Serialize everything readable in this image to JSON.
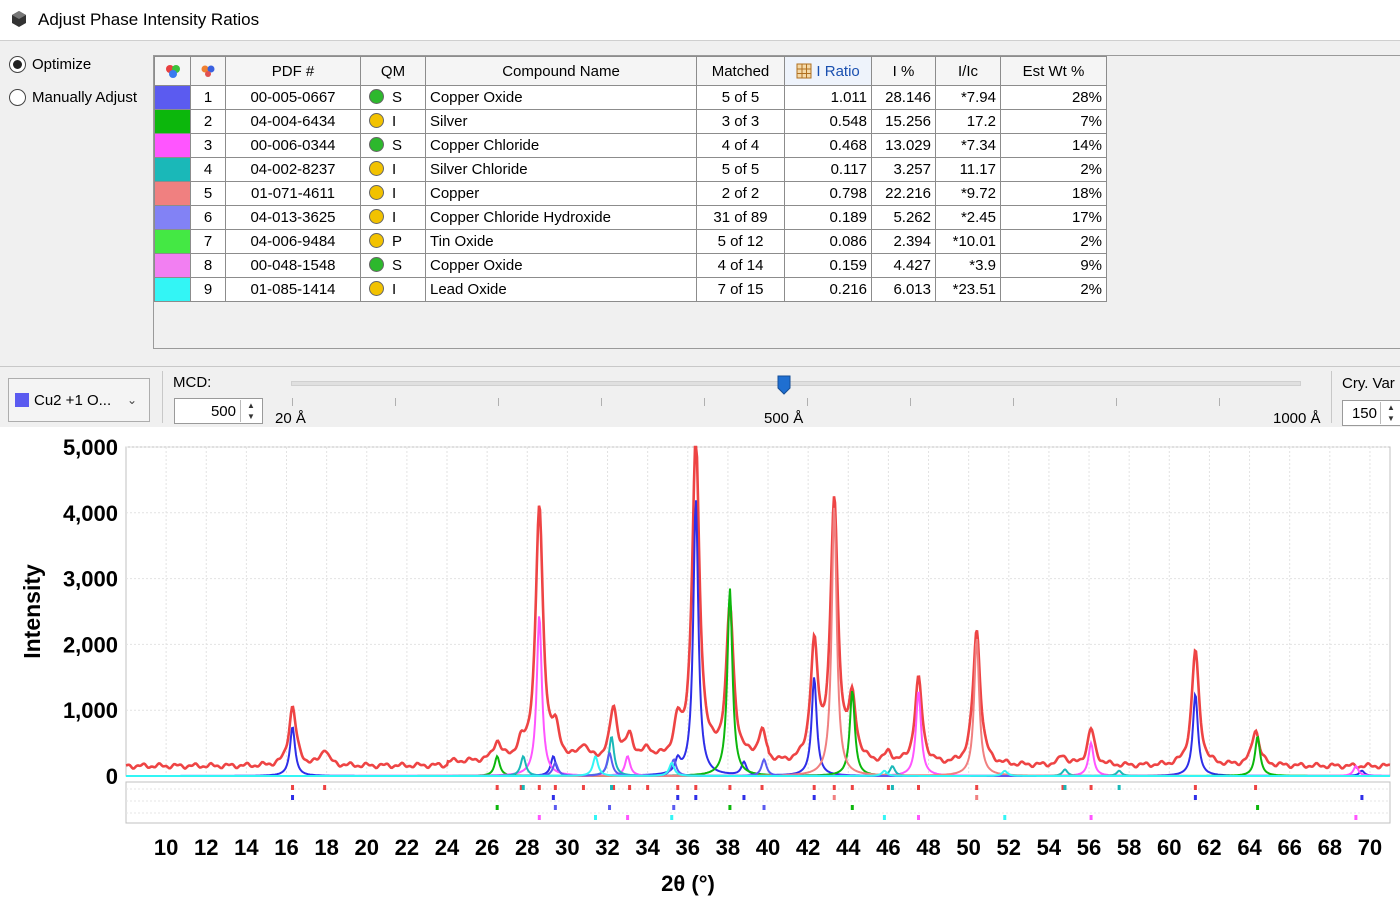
{
  "window": {
    "title": "Adjust Phase Intensity Ratios"
  },
  "mode": {
    "optimize_label": "Optimize",
    "manual_label": "Manually Adjust",
    "selected": "optimize"
  },
  "table": {
    "headers": {
      "pdf": "PDF #",
      "qm": "QM",
      "compound": "Compound Name",
      "matched": "Matched",
      "iratio": "I Ratio",
      "ipct": "I %",
      "iic": "I/Ic",
      "estwt": "Est Wt %"
    },
    "rows": [
      {
        "color": "#5b5bf0",
        "num": "1",
        "pdf": "00-005-0667",
        "qm_color": "#2db82d",
        "qm": "S",
        "compound": "Copper Oxide",
        "matched": "5 of 5",
        "iratio": "1.011",
        "ipct": "28.146",
        "iic": "*7.94",
        "estwt": "28%"
      },
      {
        "color": "#0cb70c",
        "num": "2",
        "pdf": "04-004-6434",
        "qm_color": "#f2c200",
        "qm": "I",
        "compound": "Silver",
        "matched": "3 of 3",
        "iratio": "0.548",
        "ipct": "15.256",
        "iic": "17.2",
        "estwt": "7%"
      },
      {
        "color": "#ff55ff",
        "num": "3",
        "pdf": "00-006-0344",
        "qm_color": "#2db82d",
        "qm": "S",
        "compound": "Copper Chloride",
        "matched": "4 of 4",
        "iratio": "0.468",
        "ipct": "13.029",
        "iic": "*7.34",
        "estwt": "14%"
      },
      {
        "color": "#1ab8b8",
        "num": "4",
        "pdf": "04-002-8237",
        "qm_color": "#f2c200",
        "qm": "I",
        "compound": "Silver Chloride",
        "matched": "5 of 5",
        "iratio": "0.117",
        "ipct": "3.257",
        "iic": "11.17",
        "estwt": "2%"
      },
      {
        "color": "#f08080",
        "num": "5",
        "pdf": "01-071-4611",
        "qm_color": "#f2c200",
        "qm": "I",
        "compound": "Copper",
        "matched": "2 of 2",
        "iratio": "0.798",
        "ipct": "22.216",
        "iic": "*9.72",
        "estwt": "18%"
      },
      {
        "color": "#8282f5",
        "num": "6",
        "pdf": "04-013-3625",
        "qm_color": "#f2c200",
        "qm": "I",
        "compound": "Copper Chloride Hydroxide",
        "matched": "31 of 89",
        "iratio": "0.189",
        "ipct": "5.262",
        "iic": "*2.45",
        "estwt": "17%"
      },
      {
        "color": "#44e844",
        "num": "7",
        "pdf": "04-006-9484",
        "qm_color": "#f2c200",
        "qm": "P",
        "compound": "Tin Oxide",
        "matched": "5 of 12",
        "iratio": "0.086",
        "ipct": "2.394",
        "iic": "*10.01",
        "estwt": "2%"
      },
      {
        "color": "#f27ff2",
        "num": "8",
        "pdf": "00-048-1548",
        "qm_color": "#2db82d",
        "qm": "S",
        "compound": "Copper Oxide",
        "matched": "4 of 14",
        "iratio": "0.159",
        "ipct": "4.427",
        "iic": "*3.9",
        "estwt": "9%"
      },
      {
        "color": "#33f5f5",
        "num": "9",
        "pdf": "01-085-1414",
        "qm_color": "#f2c200",
        "qm": "I",
        "compound": "Lead Oxide",
        "matched": "7 of 15",
        "iratio": "0.216",
        "ipct": "6.013",
        "iic": "*23.51",
        "estwt": "2%"
      }
    ]
  },
  "controls": {
    "phase_selector": {
      "label": "Cu2 +1 O...",
      "color": "#5b5bf0"
    },
    "mcd_label": "MCD:",
    "mcd_value": "500",
    "slider_min_label": "20 Å",
    "slider_mid_label": "500 Å",
    "slider_max_label": "1000 Å",
    "slider_value": 500,
    "cry_label": "Cry. Var",
    "cry_value": "150"
  },
  "chart_data": {
    "type": "line",
    "xlabel": "2θ (°)",
    "ylabel": "Intensity",
    "xlim": [
      8,
      71
    ],
    "ylim": [
      0,
      5000
    ],
    "xticks": [
      10,
      12,
      14,
      16,
      18,
      20,
      22,
      24,
      26,
      28,
      30,
      32,
      34,
      36,
      38,
      40,
      42,
      44,
      46,
      48,
      50,
      52,
      54,
      56,
      58,
      60,
      62,
      64,
      66,
      68,
      70
    ],
    "yticks": [
      0,
      1000,
      2000,
      3000,
      4000,
      5000
    ],
    "ytick_labels": [
      "0",
      "1,000",
      "2,000",
      "3,000",
      "4,000",
      "5,000"
    ],
    "grid": true,
    "baseline": 150,
    "series": [
      {
        "color": "#ee4444",
        "peaks": [
          [
            16.3,
            900
          ],
          [
            17.9,
            250
          ],
          [
            26.5,
            280
          ],
          [
            27.7,
            200
          ],
          [
            28.6,
            3850
          ],
          [
            29.4,
            400
          ],
          [
            30.8,
            220
          ],
          [
            32.3,
            800
          ],
          [
            33.1,
            350
          ],
          [
            34.0,
            150
          ],
          [
            35.5,
            500
          ],
          [
            36.4,
            4850
          ],
          [
            38.1,
            2300
          ],
          [
            39.7,
            400
          ],
          [
            42.3,
            1750
          ],
          [
            43.3,
            3950
          ],
          [
            44.2,
            900
          ],
          [
            46.0,
            150
          ],
          [
            47.5,
            1300
          ],
          [
            50.4,
            2050
          ],
          [
            54.7,
            150
          ],
          [
            56.1,
            550
          ],
          [
            61.3,
            1750
          ],
          [
            64.3,
            550
          ]
        ]
      },
      {
        "color": "#2e2ee8",
        "peaks": [
          [
            16.3,
            750
          ],
          [
            29.3,
            300
          ],
          [
            35.5,
            200
          ],
          [
            36.4,
            4200
          ],
          [
            38.8,
            200
          ],
          [
            42.3,
            1500
          ],
          [
            61.3,
            1250
          ],
          [
            69.6,
            80
          ]
        ]
      },
      {
        "color": "#0cb70c",
        "peaks": [
          [
            26.5,
            300
          ],
          [
            38.1,
            2850
          ],
          [
            44.2,
            1300
          ],
          [
            64.4,
            600
          ]
        ]
      },
      {
        "color": "#ff55ff",
        "peaks": [
          [
            28.6,
            2450
          ],
          [
            33.0,
            300
          ],
          [
            47.5,
            1300
          ],
          [
            56.1,
            500
          ],
          [
            69.3,
            150
          ]
        ]
      },
      {
        "color": "#1ab8b8",
        "peaks": [
          [
            27.8,
            300
          ],
          [
            32.2,
            600
          ],
          [
            46.2,
            150
          ],
          [
            54.8,
            100
          ],
          [
            57.5,
            80
          ]
        ]
      },
      {
        "color": "#f08080",
        "peaks": [
          [
            43.3,
            4100
          ],
          [
            50.4,
            2100
          ]
        ]
      },
      {
        "color": "#5b5bf0",
        "peaks": [
          [
            29.4,
            200
          ],
          [
            32.1,
            350
          ],
          [
            35.3,
            250
          ],
          [
            39.8,
            250
          ]
        ]
      },
      {
        "color": "#33f5f5",
        "peaks": [
          [
            31.4,
            300
          ],
          [
            35.2,
            200
          ],
          [
            45.8,
            80
          ],
          [
            51.8,
            80
          ]
        ]
      }
    ]
  }
}
